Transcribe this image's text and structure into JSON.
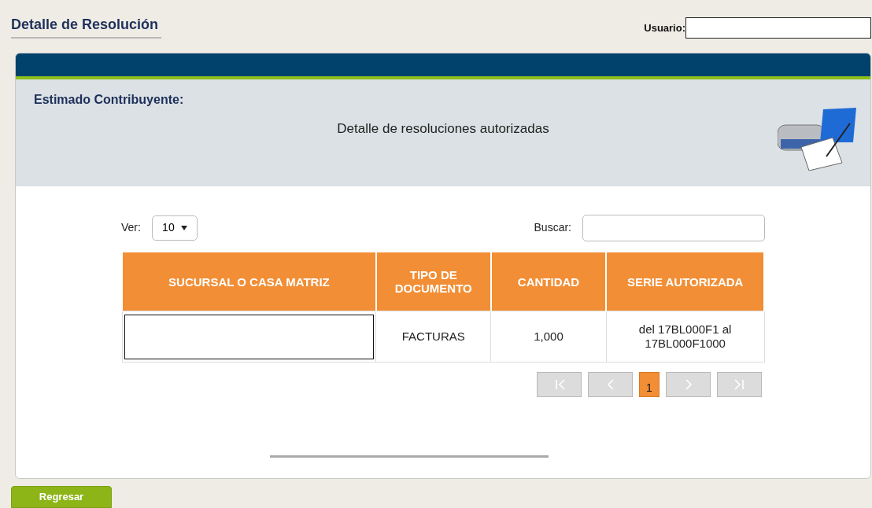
{
  "page_title": "Detalle de Resolución",
  "user_field": {
    "label": "Usuario:"
  },
  "panel": {
    "heading": "Estimado Contribuyente:",
    "subtitle": "Detalle de resoluciones autorizadas"
  },
  "table_controls": {
    "show_label": "Ver:",
    "show_value": "10",
    "search_label": "Buscar:"
  },
  "table": {
    "columns": [
      "SUCURSAL O CASA MATRIZ",
      "TIPO DE DOCUMENTO",
      "CANTIDAD",
      "SERIE AUTORIZADA"
    ],
    "rows": [
      {
        "cells": [
          {
            "kind": "blank"
          },
          {
            "kind": "text",
            "text": "FACTURAS"
          },
          {
            "kind": "text",
            "text": "1,000"
          },
          {
            "kind": "text",
            "text": "del 17BL000F1 al 17BL000F1000"
          }
        ]
      }
    ]
  },
  "pagination": {
    "pages": [
      {
        "label": "1",
        "selected": true
      }
    ]
  },
  "back_button": "Regresar"
}
